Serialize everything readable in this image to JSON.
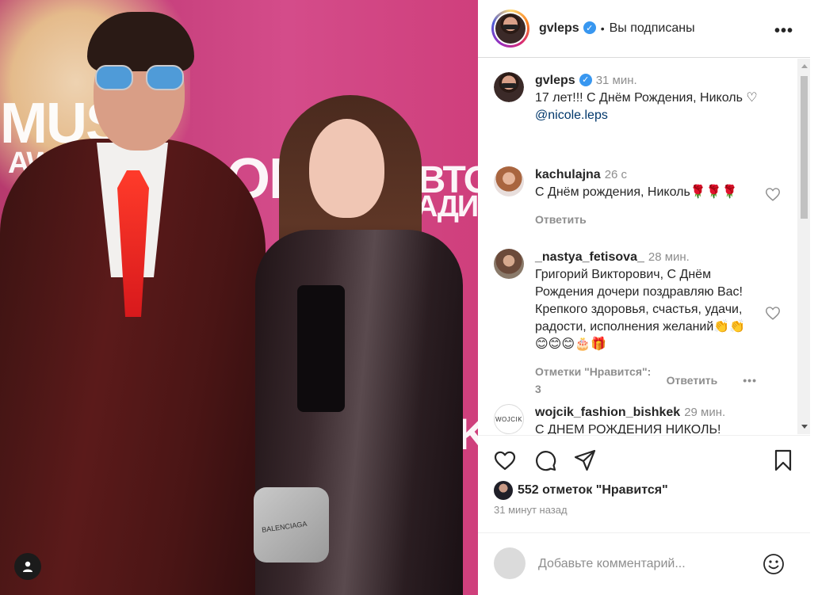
{
  "post": {
    "author": "gvleps",
    "follow_status": "Вы подписаны",
    "dot": "•",
    "more": "•••"
  },
  "photo": {
    "backdrop_texts": [
      "MUSI",
      "AWA",
      "OK",
      "АВТО",
      "РАДИО",
      "OK!"
    ],
    "bag_label": "BALENCIAGA"
  },
  "caption": {
    "username": "gvleps",
    "time": "31 мин.",
    "text": "17 лет!!! С Днём Рождения, Николь ♡",
    "mention": "@nicole.leps"
  },
  "comments": [
    {
      "username": "kachulajna",
      "time": "26 с",
      "text": "С Днём рождения, Николь🌹🌹🌹",
      "reply_label": "Ответить"
    },
    {
      "username": "_nastya_fetisova_",
      "time": "28 мин.",
      "text": "Григорий Викторович, С Днём Рождения дочери поздравляю Вас! Крепкого здоровья, счастья, удачи, радости, исполнения желаний👏👏 😊😊😊🎂🎁",
      "likes_label": "Отметки \"Нравится\": 3",
      "reply_label": "Ответить",
      "more": "•••"
    },
    {
      "username": "wojcik_fashion_bishkek",
      "time": "29 мин.",
      "text": "С ДНЕМ РОЖДЕНИЯ НИКОЛЬ!",
      "avatar_label": "WOJCIK"
    }
  ],
  "likes": {
    "text": "552 отметок \"Нравится\""
  },
  "time_ago": "31 минут назад",
  "add_comment": {
    "placeholder": "Добавьте комментарий..."
  },
  "colors": {
    "link": "#00376b",
    "secondary": "#8e8e8e",
    "verified": "#3897f0"
  }
}
